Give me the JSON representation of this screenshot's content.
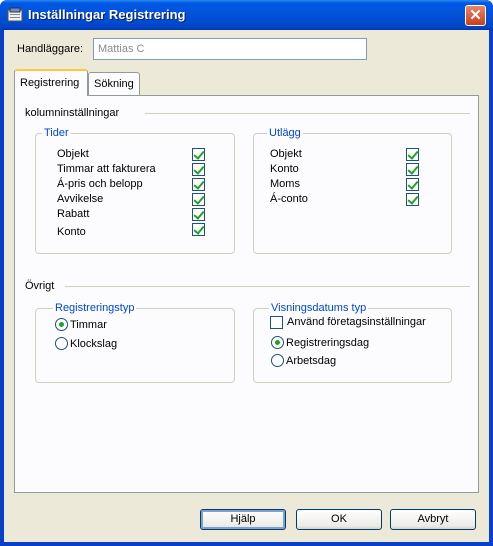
{
  "window": {
    "title": "Inställningar Registrering",
    "close_glyph": "✕"
  },
  "handler": {
    "label": "Handläggare:",
    "value": "Mattias C"
  },
  "tabs": [
    {
      "label": "Registrering",
      "active": true
    },
    {
      "label": "Sökning",
      "active": false
    }
  ],
  "columns_section": {
    "title": "kolumninställningar",
    "tider": {
      "title": "Tider",
      "items": [
        {
          "label": "Objekt",
          "checked": true
        },
        {
          "label": "Timmar att fakturera",
          "checked": true
        },
        {
          "label": "Á-pris och belopp",
          "checked": true
        },
        {
          "label": "Avvikelse",
          "checked": true
        },
        {
          "label": "Rabatt",
          "checked": true
        },
        {
          "label": "Konto",
          "checked": true
        }
      ]
    },
    "utlagg": {
      "title": "Utlägg",
      "items": [
        {
          "label": "Objekt",
          "checked": true
        },
        {
          "label": "Konto",
          "checked": true
        },
        {
          "label": "Moms",
          "checked": true
        },
        {
          "label": "Á-conto",
          "checked": true
        }
      ]
    }
  },
  "other_section": {
    "title": "Övrigt",
    "registreringstyp": {
      "title": "Registreringstyp",
      "options": [
        {
          "label": "Timmar",
          "selected": true
        },
        {
          "label": "Klockslag",
          "selected": false
        }
      ]
    },
    "visningsdatum": {
      "title": "Visningsdatums typ",
      "use_company_label": "Använd företagsinställningar",
      "use_company_checked": false,
      "options": [
        {
          "label": "Registreringsdag",
          "selected": true
        },
        {
          "label": "Arbetsdag",
          "selected": false
        }
      ]
    }
  },
  "buttons": {
    "help": "Hjälp",
    "ok": "OK",
    "cancel": "Avbryt"
  },
  "colors": {
    "titlebar": "#0058e6",
    "group_title": "#0046d5",
    "check": "#21a121",
    "face": "#ece9d8"
  }
}
